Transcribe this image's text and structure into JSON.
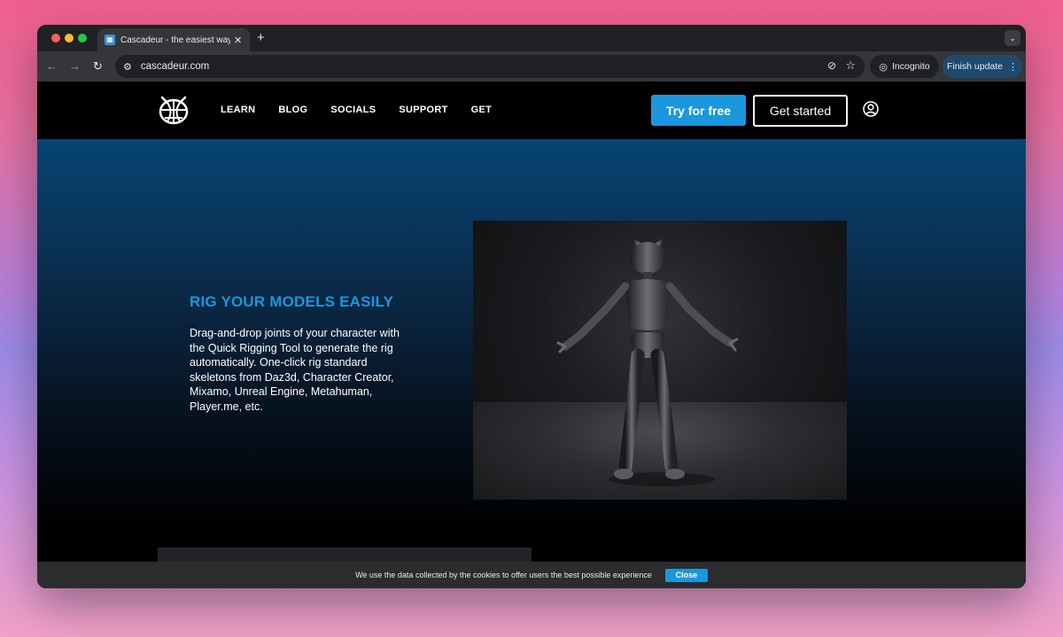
{
  "browser": {
    "tab_title": "Cascadeur - the easiest way t",
    "tab_close": "✕",
    "new_tab": "+",
    "url": "cascadeur.com",
    "incognito_label": "Incognito",
    "finish_update_label": "Finish update"
  },
  "site": {
    "nav": [
      "LEARN",
      "BLOG",
      "SOCIALS",
      "SUPPORT",
      "GET"
    ],
    "try_free_label": "Try for free",
    "get_started_label": "Get started"
  },
  "hero": {
    "title": "RIG YOUR MODELS EASILY",
    "text": "Drag-and-drop joints of your character with the Quick Rigging Tool to generate the rig automatically. One-click rig standard skeletons from Daz3d, Character Creator, Mixamo, Unreal Engine, Metahuman, Player.me, etc."
  },
  "cookie": {
    "text": "We use the data collected by the cookies to offer users the best possible experience",
    "close_label": "Close"
  },
  "colors": {
    "accent": "#1b97de",
    "update_button": "#1f4a6e"
  }
}
